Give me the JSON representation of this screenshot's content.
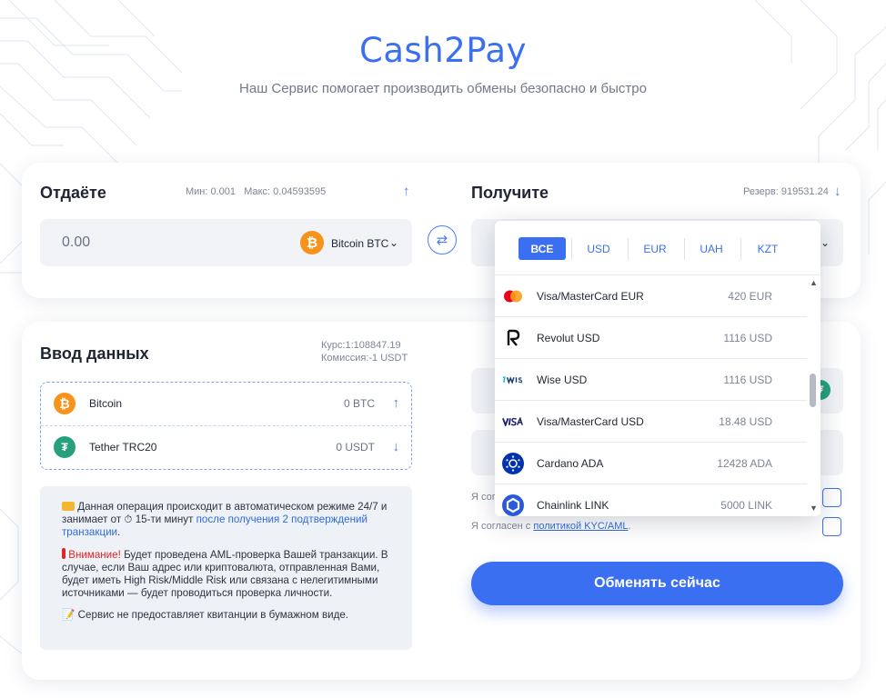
{
  "brand": {
    "title": "Cash2Pay",
    "subtitle": "Наш Сервис помогает производить обмены безопасно и быстро"
  },
  "give": {
    "title": "Отдаёте",
    "limits": "Мин: 0.001   Макс: 0.04593595",
    "amount": "0.00",
    "currency_label": "Bitcoin BTC",
    "currency_icon": "bitcoin-icon"
  },
  "receive": {
    "title": "Получите",
    "reserve": "Резерв: 919531.24"
  },
  "dropdown": {
    "tabs": [
      {
        "label": "ВСЕ",
        "active": true
      },
      {
        "label": "USD",
        "active": false
      },
      {
        "label": "EUR",
        "active": false
      },
      {
        "label": "UAH",
        "active": false
      },
      {
        "label": "KZT",
        "active": false
      }
    ],
    "items": [
      {
        "name": "Visa/MasterCard EUR",
        "amount": "420 EUR",
        "icon": "mastercard-icon"
      },
      {
        "name": "Revolut USD",
        "amount": "1116 USD",
        "icon": "revolut-icon"
      },
      {
        "name": "Wise USD",
        "amount": "1116 USD",
        "icon": "wise-icon"
      },
      {
        "name": "Visa/MasterCard USD",
        "amount": "18.48 USD",
        "icon": "visa-icon"
      },
      {
        "name": "Cardano ADA",
        "amount": "12428 ADA",
        "icon": "cardano-icon"
      },
      {
        "name": "Chainlink LINK",
        "amount": "5000 LINK",
        "icon": "chainlink-icon"
      }
    ]
  },
  "input_data": {
    "title": "Ввод данных",
    "rate": "Курс:1:108847.19",
    "commission": "Комиссия:-1 USDT",
    "pairs": [
      {
        "name": "Bitcoin",
        "amount": "0 BTC",
        "icon": "bitcoin-icon"
      },
      {
        "name": "Tether TRC20",
        "amount": "0 USDT",
        "icon": "tether-icon"
      }
    ]
  },
  "info": {
    "p1_pre": "Данная операция происходит в автоматическом режиме 24/7 и занимает от",
    "p1_mid": "15-ти минут",
    "p1_link": "после получения 2 подтверждений транзакции",
    "p1_end": ".",
    "p2_warn": "Внимание!",
    "p2_text": "Будет проведена AML-проверка Вашей транзакции. В случае, если Ваш адрес или криптовалюта, отправленная Вами, будет иметь High Risk/Middle Risk или связана с нелегитимными источниками — будет проводиться проверка личности.",
    "p3": "Сервис не предоставляет квитанции в бумажном виде."
  },
  "agreements": {
    "first_partial": "Я согла",
    "second_pre": "Я согласен с",
    "second_link": "политикой KYC/AML",
    "second_end": "."
  },
  "exchange_button": "Обменять сейчас",
  "colors": {
    "accent": "#3b6ff2",
    "bitcoin": "#f7931a",
    "tether": "#26a17b",
    "cardano": "#0033ad",
    "chainlink": "#2a5ada",
    "warning": "#e02626"
  }
}
